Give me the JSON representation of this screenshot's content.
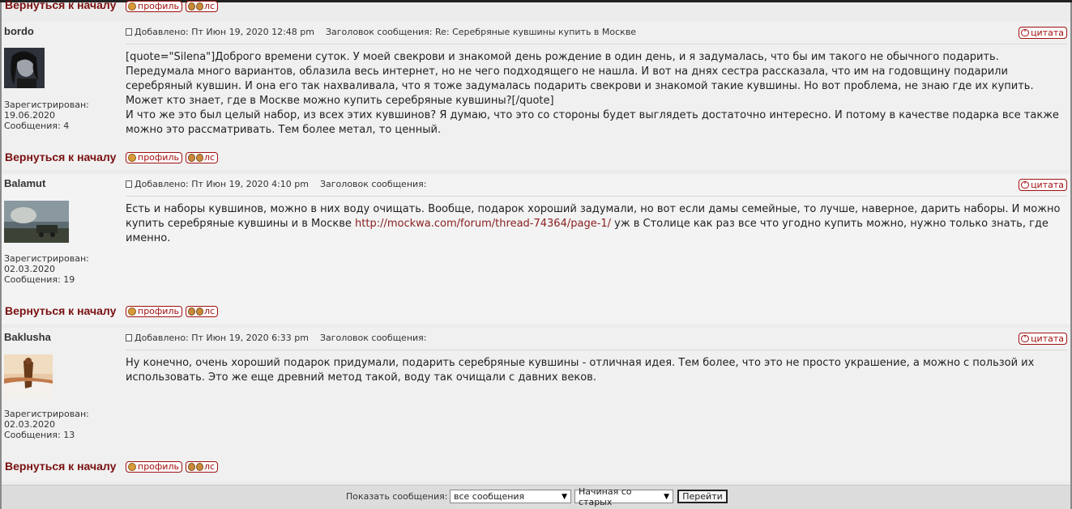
{
  "top": {
    "back_label": "Вернуться к началу",
    "profile_label": "профиль",
    "pm_label": "лс"
  },
  "posts": [
    {
      "author": "bordo",
      "registered_label": "Зарегистрирован:",
      "registered_date": "19.06.2020",
      "messages_label": "Сообщения: 4",
      "posted": "Добавлено: Пт Июн 19, 2020 12:48 pm",
      "subject": "Заголовок сообщения: Re: Серебряные кувшины купить в Москве",
      "quote_label": "цитата",
      "body_lines": [
        "[quote=\"Silena\"]Доброго времени суток. У моей свекрови и знакомой день рождение в один день, и я задумалась, что бы им такого не обычного подарить. Передумала много вариантов, облазила весь интернет, но не чего подходящего не нашла. И вот на днях сестра рассказала, что им на годовщину подарили серебряный кувшин. И она его так нахваливала, что я тоже задумалась подарить свекрови и знакомой такие кувшины. Но вот проблема, не знаю где их купить. Может кто знает, где в Москве можно купить серебряные кувшины?[/quote]",
        "И что же это был целый набор, из всех этих кувшинов? Я думаю, что это со стороны будет выглядеть достаточно интересно. И потому в качестве подарка все также можно это рассматривать. Тем более метал, то ценный."
      ],
      "back_label": "Вернуться к началу",
      "profile_label": "профиль",
      "pm_label": "лс"
    },
    {
      "author": "Balamut",
      "registered_label": "Зарегистрирован:",
      "registered_date": "02.03.2020",
      "messages_label": "Сообщения: 19",
      "posted": "Добавлено: Пт Июн 19, 2020 4:10 pm",
      "subject": "Заголовок сообщения:",
      "quote_label": "цитата",
      "body_before": "Есть и наборы кувшинов, можно в них воду очищать. Вообще, подарок хороший задумали, но вот если дамы семейные, то лучше, наверное, дарить наборы. И можно купить серебряные кувшины и в Москве ",
      "body_link": "http://mockwa.com/forum/thread-74364/page-1/",
      "body_after": " уж в Столице как раз все что угодно купить можно, нужно только знать, где именно.",
      "back_label": "Вернуться к началу",
      "profile_label": "профиль",
      "pm_label": "лс"
    },
    {
      "author": "Baklusha",
      "registered_label": "Зарегистрирован:",
      "registered_date": "02.03.2020",
      "messages_label": "Сообщения: 13",
      "posted": "Добавлено: Пт Июн 19, 2020 6:33 pm",
      "subject": "Заголовок сообщения:",
      "quote_label": "цитата",
      "body": "Ну конечно, очень хороший подарок придумали, подарить серебряные кувшины - отличная идея. Тем более, что это не просто украшение, а можно с пользой их использовать. Это же еще древний метод такой, воду так очищали с давних веков.",
      "back_label": "Вернуться к началу",
      "profile_label": "профиль",
      "pm_label": "лс"
    }
  ],
  "footer": {
    "show_label": "Показать сообщения:",
    "filter_value": "все сообщения",
    "order_value": "Начиная со старых",
    "go_label": "Перейти"
  },
  "colors": {
    "accent": "#7a1010",
    "link": "#8a2020"
  }
}
